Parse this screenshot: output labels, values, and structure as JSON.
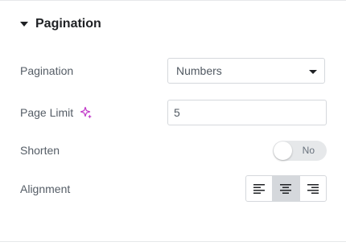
{
  "section": {
    "title": "Pagination",
    "expanded": true
  },
  "fields": {
    "pagination": {
      "label": "Pagination",
      "value": "Numbers"
    },
    "page_limit": {
      "label": "Page Limit",
      "value": "5",
      "icon": "ai-sparkle-icon"
    },
    "shorten": {
      "label": "Shorten",
      "toggle_text": "No",
      "on": false
    },
    "alignment": {
      "label": "Alignment",
      "options": [
        {
          "name": "align-left",
          "icon": "align-left-icon",
          "active": false
        },
        {
          "name": "align-center",
          "icon": "align-center-icon",
          "active": true
        },
        {
          "name": "align-right",
          "icon": "align-right-icon",
          "active": false
        }
      ]
    }
  },
  "colors": {
    "ai_accent": "#c036c8",
    "active_button_bg": "#d5d8dc",
    "toggle_bg": "#e6e8ea",
    "title_text": "#1f2124",
    "label_text": "#555d66"
  }
}
